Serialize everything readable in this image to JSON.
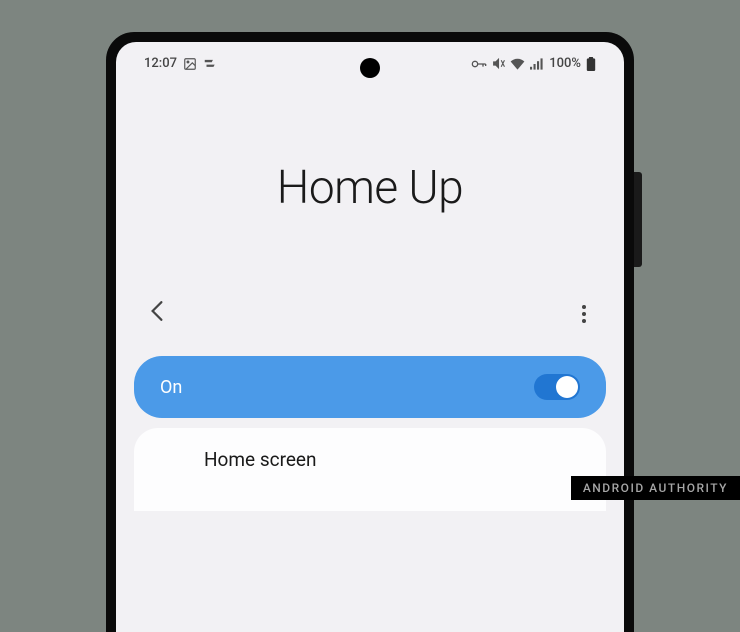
{
  "status_bar": {
    "time": "12:07",
    "battery_pct": "100%"
  },
  "page": {
    "title": "Home Up"
  },
  "main_toggle": {
    "label": "On",
    "enabled": true
  },
  "items": [
    {
      "label": "Home screen"
    }
  ],
  "watermark": "ANDROID AUTHORITY"
}
